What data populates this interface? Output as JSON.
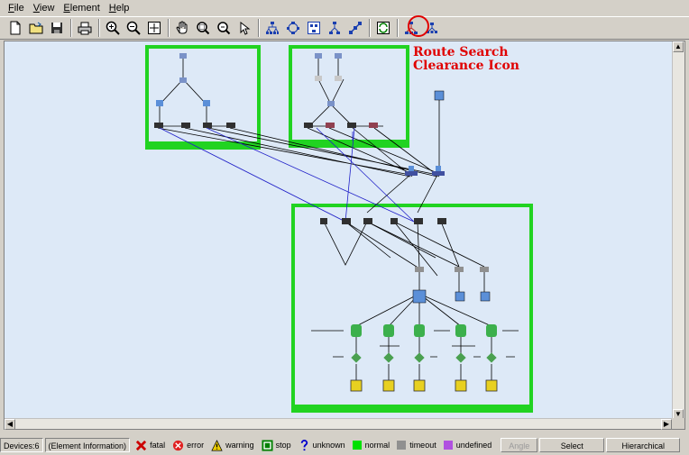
{
  "menu": {
    "items": [
      {
        "label": "File"
      },
      {
        "label": "View"
      },
      {
        "label": "Element"
      },
      {
        "label": "Help"
      }
    ]
  },
  "toolbar": {
    "buttons": [
      {
        "icon": "new-document-icon"
      },
      {
        "icon": "open-folder-icon"
      },
      {
        "icon": "save-icon"
      },
      {
        "icon": "print-icon"
      },
      {
        "icon": "zoom-in-icon"
      },
      {
        "icon": "zoom-out-icon"
      },
      {
        "icon": "fit-window-icon"
      },
      {
        "icon": "pan-hand-icon"
      },
      {
        "icon": "zoom-area-icon"
      },
      {
        "icon": "zoom-select-icon"
      },
      {
        "icon": "select-pointer-icon"
      },
      {
        "icon": "layout-tree-icon"
      },
      {
        "icon": "layout-circle-icon"
      },
      {
        "icon": "layout-group-icon"
      },
      {
        "icon": "layout-hierarchy-icon"
      },
      {
        "icon": "route-search-icon"
      },
      {
        "icon": "refresh-icon"
      },
      {
        "icon": "network-route-icon"
      },
      {
        "icon": "route-search-clearance-icon"
      }
    ]
  },
  "annotation": {
    "line1": "Route Search",
    "line2": "Clearance Icon",
    "color": "#e00000"
  },
  "canvas": {
    "background": "#dde9f7",
    "group_color": "#21d321"
  },
  "status": {
    "devices": "Devices:6",
    "element_info": "(Element Information)",
    "legend": [
      {
        "label": "fatal",
        "icon": "fatal-x-icon",
        "color": "#cc0000"
      },
      {
        "label": "error",
        "icon": "error-circle-icon",
        "color": "#e02020"
      },
      {
        "label": "warning",
        "icon": "warning-triangle-icon",
        "color": "#f0d000"
      },
      {
        "label": "stop",
        "icon": "stop-square-icon",
        "color": "#008000"
      },
      {
        "label": "unknown",
        "icon": "question-icon",
        "color": "#0000cc"
      },
      {
        "label": "normal",
        "icon": "normal-swatch",
        "color": "#00e000"
      },
      {
        "label": "timeout",
        "icon": "timeout-swatch",
        "color": "#909090"
      },
      {
        "label": "undefined",
        "icon": "undefined-swatch",
        "color": "#b050e0"
      }
    ],
    "angle_label": "Angle",
    "select_label": "Select",
    "layout_label": "Hierarchical"
  }
}
